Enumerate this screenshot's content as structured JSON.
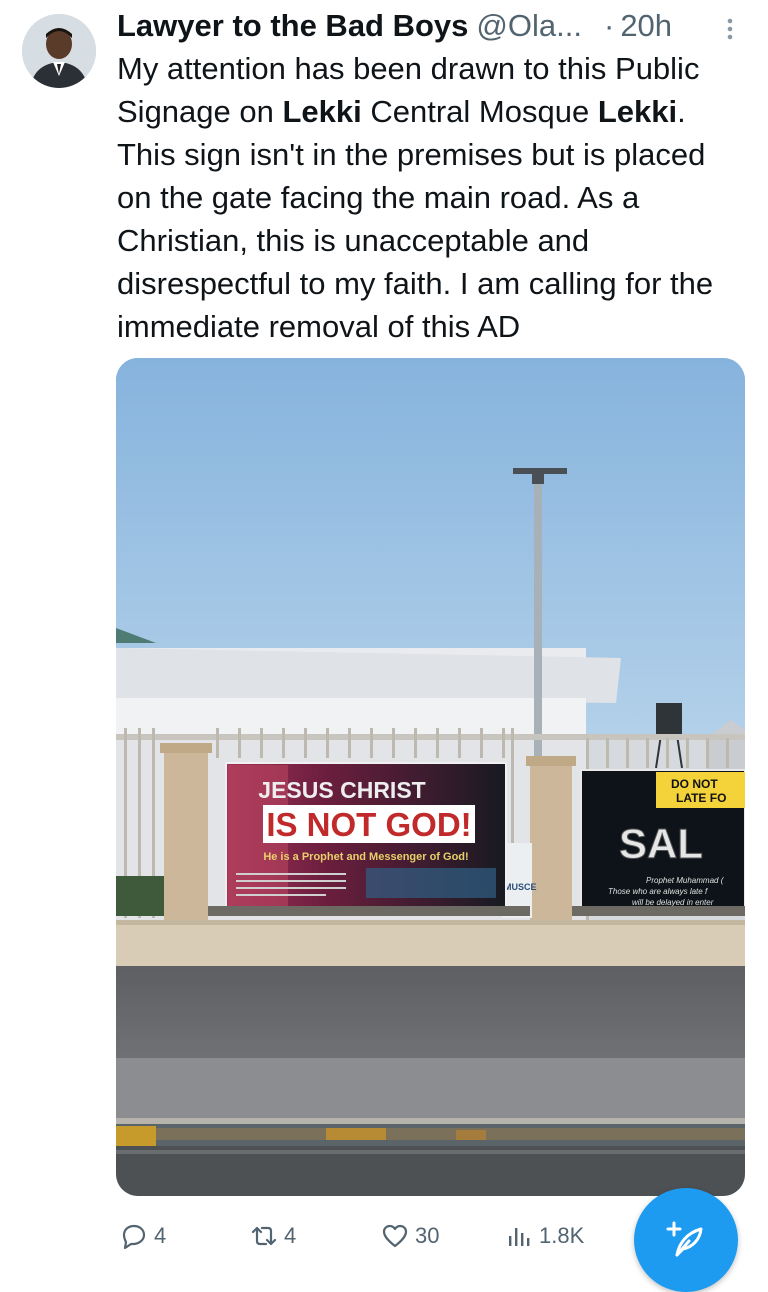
{
  "tweet": {
    "author_name": "Lawyer to the Bad Boys",
    "author_handle": "@Ola...",
    "separator": "·",
    "time": "20h",
    "text": {
      "p1": "My attention has been drawn to this Public Signage on ",
      "b1": "Lekki",
      "p2": " Central Mosque ",
      "b2": "Lekki",
      "p3": ". This sign isn't in the premises but is placed on the gate facing the main road. As a Christian, this is unacceptable and disrespectful to my faith. I am calling for the immediate removal of this AD"
    }
  },
  "media": {
    "banner": {
      "line1": "JESUS CHRIST",
      "line2": "IS NOT GOD!",
      "line3": "He is a Prophet and Messenger of God!"
    },
    "banner2": {
      "line1": "DO NOT",
      "line2": "LATE FO",
      "line3": "SAL",
      "line4": "Prophet Muhammad (",
      "line5": "Those who are always late f",
      "line6": "will be delayed in enter"
    },
    "truck_sign": "MUSCE"
  },
  "actions": {
    "replies": "4",
    "reposts": "4",
    "likes": "30",
    "views": "1.8K"
  },
  "icons": {
    "reply": "reply-icon",
    "repost": "repost-icon",
    "like": "heart-icon",
    "views": "views-icon",
    "compose": "compose-icon",
    "more": "more-icon"
  },
  "colors": {
    "accent": "#1d9bf0",
    "muted": "#536471"
  }
}
